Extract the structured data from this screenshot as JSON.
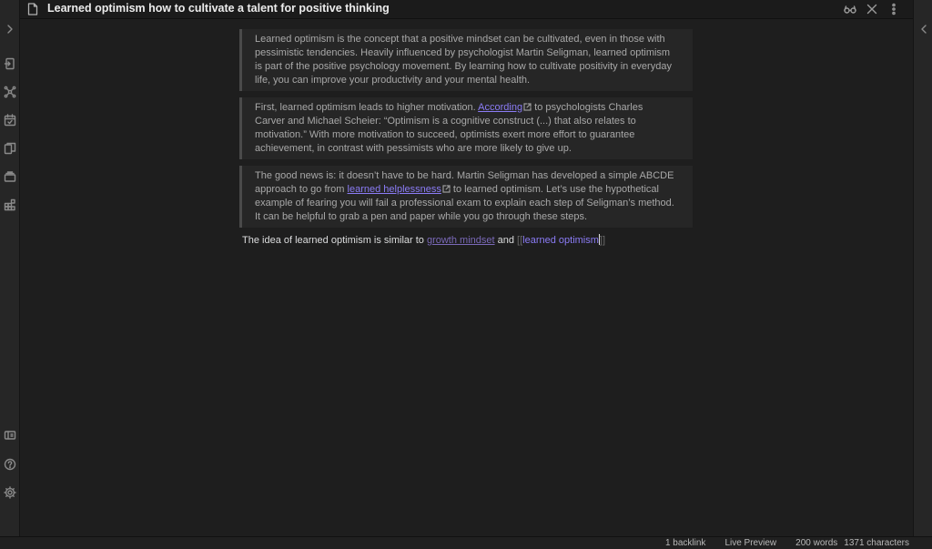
{
  "note": {
    "title": "Learned optimism how to cultivate a talent for positive thinking"
  },
  "ribbon": {
    "icons": [
      "chevron-right-icon",
      "open-quick-switcher-icon",
      "graph-view-icon",
      "daily-note-icon",
      "templates-icon",
      "slides-icon",
      "plugins-icon",
      "vault-icon",
      "help-icon",
      "settings-icon"
    ]
  },
  "callouts": [
    {
      "lines": [
        "Learned optimism is the concept that a positive mindset can be cultivated, even in those with",
        "pessimistic tendencies. Heavily influenced by psychologist Martin Seligman, learned optimism",
        "is part of the positive psychology movement. By learning how to cultivate positivity in everyday",
        "life, you can improve your productivity and your mental health."
      ]
    },
    {
      "line1_pre": "First, learned optimism leads to higher motivation. ",
      "line1_link": "According",
      "line1_post": " to psychologists Charles",
      "lines_rest": [
        "Carver and Michael Scheier: “Optimism is a cognitive construct (...) that also relates to",
        "motivation.” With more motivation to succeed, optimists exert more effort to guarantee",
        "achievement, in contrast with pessimists who are more likely to give up."
      ]
    },
    {
      "line1": "The good news is: it doesn’t have to be hard. Martin Seligman has developed a simple ABCDE",
      "line2_pre": "approach to go from ",
      "line2_link": "learned helplessness",
      "line2_post": " to learned optimism. Let’s use the hypothetical",
      "lines_rest": [
        "example of fearing you will fail a professional exam to explain each step of Seligman’s method.",
        "It can be helpful to grab a pen and paper while you go through these steps."
      ]
    }
  ],
  "body_line": {
    "pre": "The idea of learned optimism is similar to ",
    "internal_link": "growth mindset",
    "mid": " and ",
    "open_brackets": "[[",
    "wiki_text": "learned optimism",
    "close_brackets": "]]"
  },
  "status": {
    "backlinks": "1 backlink",
    "mode": "Live Preview",
    "words": "200 words",
    "characters": "1371 characters"
  },
  "colors": {
    "accent": "#8b7cf6",
    "background": "#1e1e1e",
    "callout_bg": "#262626"
  }
}
